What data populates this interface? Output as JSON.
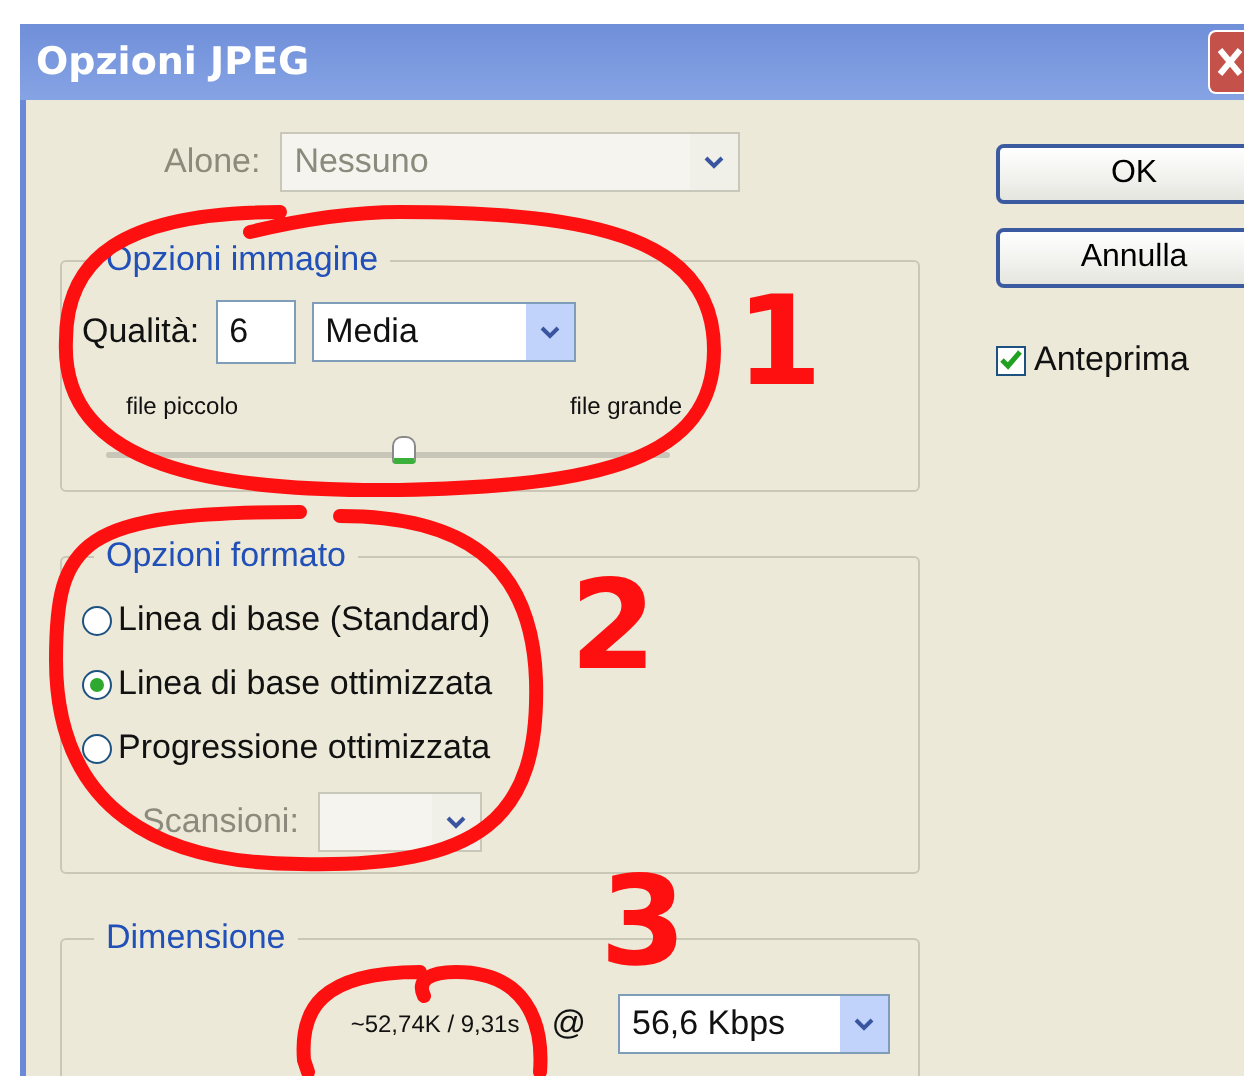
{
  "window": {
    "title": "Opzioni JPEG"
  },
  "matte": {
    "label": "Alone:",
    "value": "Nessuno",
    "disabled": true
  },
  "image_options": {
    "title": "Opzioni immagine",
    "quality_label": "Qualità:",
    "quality_value": "6",
    "quality_preset": "Media",
    "min_label": "file piccolo",
    "max_label": "file grande",
    "level": 0.53
  },
  "format_options": {
    "title": "Opzioni formato",
    "options": [
      {
        "label": "Linea di base (Standard)",
        "selected": false
      },
      {
        "label": "Linea di base ottimizzata",
        "selected": true
      },
      {
        "label": "Progressione ottimizzata",
        "selected": false
      }
    ],
    "scans": {
      "label": "Scansioni:",
      "disabled": true
    }
  },
  "size": {
    "title": "Dimensione",
    "estimate": "~52,74K / 9,31s",
    "at": "@",
    "speed": "56,6 Kbps"
  },
  "buttons": [
    "OK",
    "Annulla"
  ],
  "preview": {
    "label": "Anteprima",
    "checked": true
  },
  "annotations": [
    {
      "label": "1"
    },
    {
      "label": "2"
    },
    {
      "label": "3"
    }
  ]
}
